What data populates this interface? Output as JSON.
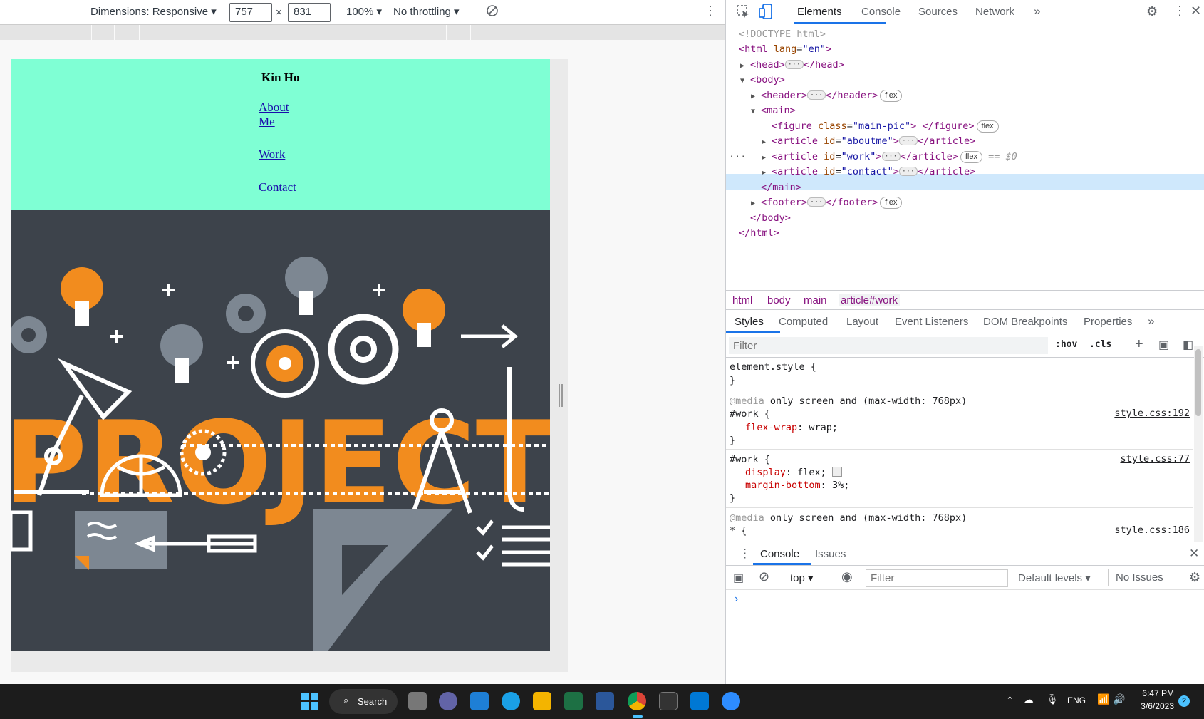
{
  "device_toolbar": {
    "dimensions_label": "Dimensions: Responsive",
    "width_value": "757",
    "times": "×",
    "height_value": "831",
    "zoom": "100%",
    "throttling": "No throttling"
  },
  "site": {
    "title": "Kin Ho",
    "nav": [
      "About Me",
      "Work",
      "Contact"
    ],
    "hero_word": "PROJECT"
  },
  "devtools": {
    "tabs": [
      "Elements",
      "Console",
      "Sources",
      "Network"
    ],
    "active_tab": "Elements",
    "dom": {
      "doctype": "<!DOCTYPE html>",
      "html_open": "<html",
      "lang_attr": "lang",
      "lang_val": "\"en\"",
      "head": "<head>",
      "head_close": "</head>",
      "body": "<body>",
      "header": "<header>",
      "header_close": "</header>",
      "main": "<main>",
      "figure": "<figure",
      "class_attr": "class",
      "figure_class": "\"main-pic\"",
      "figure_close": "</figure>",
      "article": "<article",
      "id_attr": "id",
      "aboutme_id": "\"aboutme\"",
      "work_id": "\"work\"",
      "contact_id": "\"contact\"",
      "article_close": "</article>",
      "main_close": "</main>",
      "footer": "<footer>",
      "footer_close": "</footer>",
      "body_close": "</body>",
      "html_close": "</html>",
      "flex_badge": "flex",
      "ellipsis": "···",
      "selected_marker": "== $0",
      "row_dots": "···"
    },
    "breadcrumbs": [
      "html",
      "body",
      "main",
      "article#work"
    ],
    "styles_tabs": [
      "Styles",
      "Computed",
      "Layout",
      "Event Listeners",
      "DOM Breakpoints",
      "Properties"
    ],
    "filter_placeholder": "Filter",
    "hov": ":hov",
    "cls": ".cls",
    "rules": {
      "element_style": "element.style {",
      "close": "}",
      "media1": "@media",
      "media_query": "only screen and (max-width: 768px)",
      "work_sel": "#work {",
      "flex_wrap_prop": "flex-wrap",
      "flex_wrap_val": "wrap;",
      "src1": "style.css:192",
      "display_prop": "display",
      "display_val": "flex;",
      "margin_prop": "margin-bottom",
      "margin_val": "3%;",
      "src2": "style.css:77",
      "star_sel": "* {",
      "src3": "style.css:186"
    },
    "drawer_tabs": [
      "Console",
      "Issues"
    ],
    "console": {
      "context": "top",
      "filter_placeholder": "Filter",
      "levels": "Default levels",
      "issues": "No Issues",
      "prompt": "›"
    }
  },
  "taskbar": {
    "search_label": "Search",
    "lang": "ENG",
    "time": "6:47 PM",
    "date": "3/6/2023",
    "notif_count": "2"
  },
  "colors": {
    "header_bg": "#7fffd4",
    "hero_bg": "#3d434b",
    "accent_orange": "#f28c1e",
    "devtools_accent": "#1a73e8"
  }
}
